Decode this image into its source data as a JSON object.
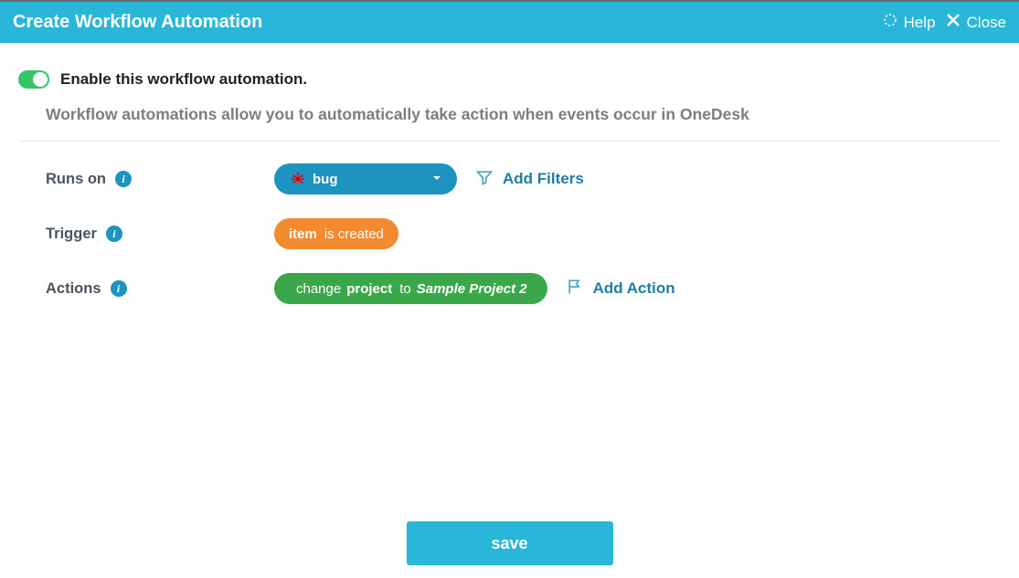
{
  "header": {
    "title": "Create Workflow Automation",
    "help_label": "Help",
    "close_label": "Close"
  },
  "enable": {
    "label": "Enable this workflow automation.",
    "on": true
  },
  "description": "Workflow automations allow you to automatically take action when events occur in OneDesk",
  "rows": {
    "runs_on": {
      "label": "Runs on",
      "value": "bug",
      "add_filters": "Add Filters"
    },
    "trigger": {
      "label": "Trigger",
      "item": "item",
      "condition": "is created"
    },
    "actions": {
      "label": "Actions",
      "verb": "change",
      "field": "project",
      "to": "to",
      "value": "Sample Project 2",
      "add_action": "Add Action"
    }
  },
  "footer": {
    "save": "save"
  }
}
